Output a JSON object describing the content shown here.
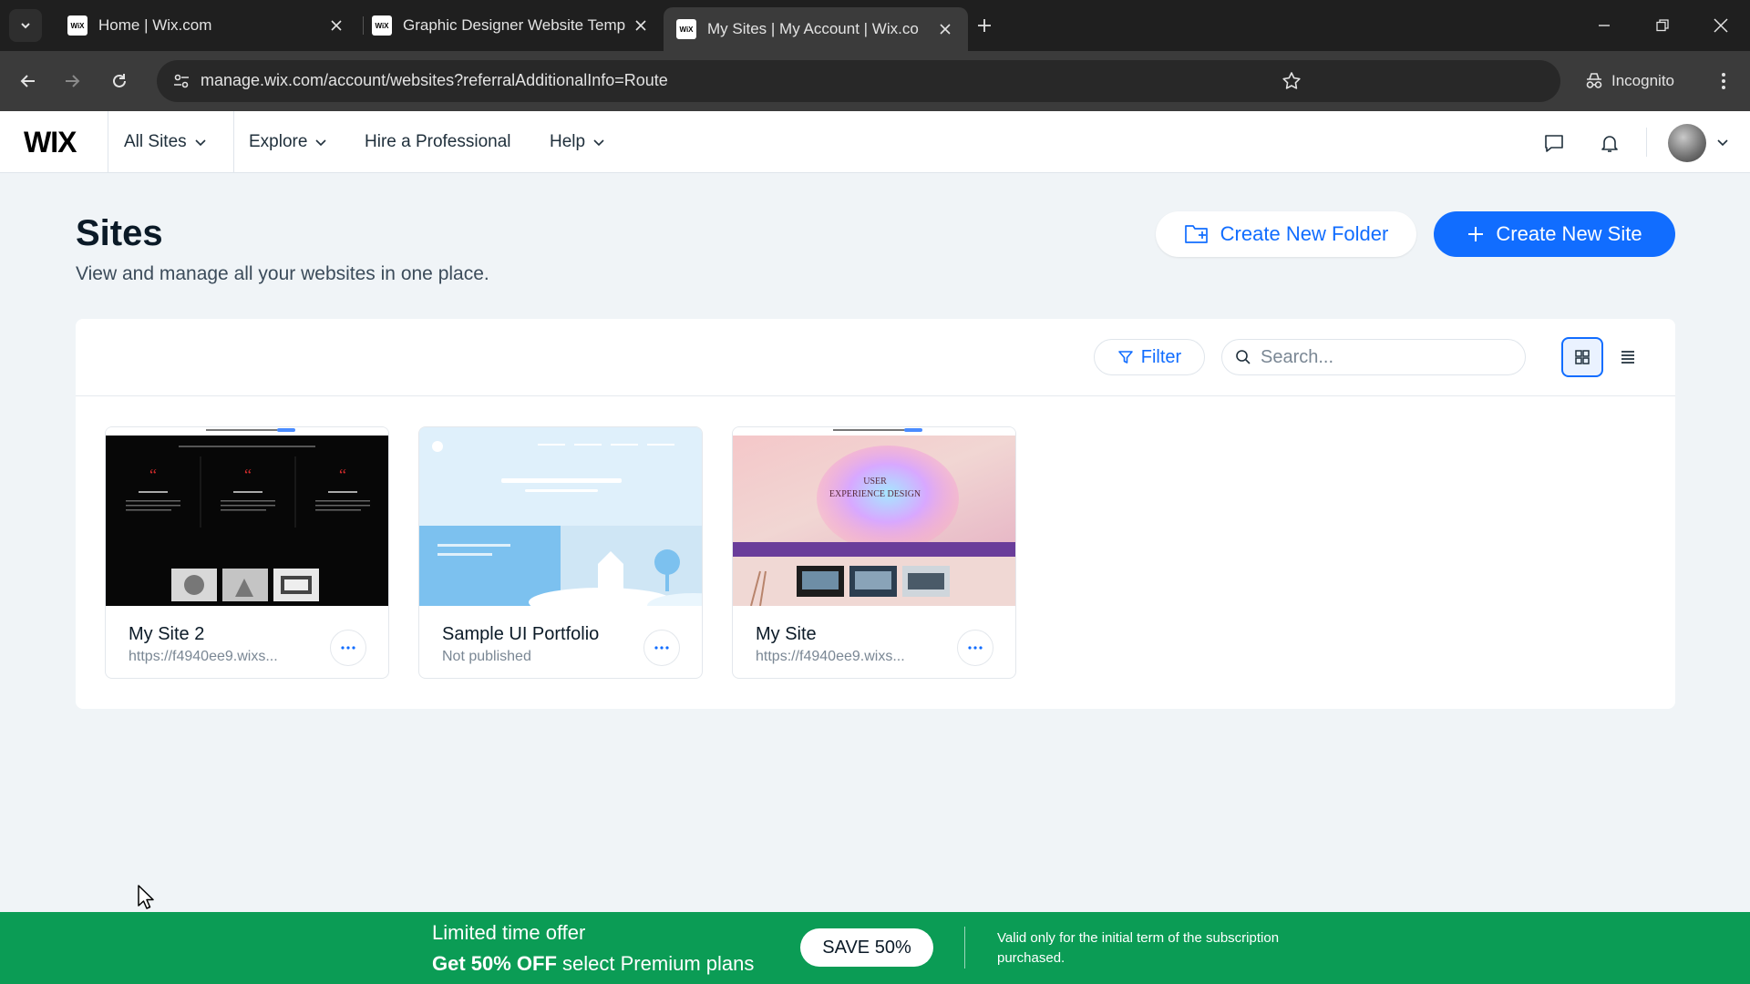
{
  "browser": {
    "tabs": [
      {
        "title": "Home | Wix.com",
        "favicon": "WiX"
      },
      {
        "title": "Graphic Designer Website Temp",
        "favicon": "WiX"
      },
      {
        "title": "My Sites | My Account | Wix.co",
        "favicon": "WiX"
      }
    ],
    "url": "manage.wix.com/account/websites?referralAdditionalInfo=Route",
    "incognito_label": "Incognito"
  },
  "header": {
    "logo": "WIX",
    "nav": [
      {
        "label": "All Sites"
      },
      {
        "label": "Explore"
      },
      {
        "label": "Hire a Professional"
      },
      {
        "label": "Help"
      }
    ]
  },
  "page": {
    "title": "Sites",
    "subtitle": "View and manage all your websites in one place.",
    "create_folder_label": "Create New Folder",
    "create_site_label": "Create New Site"
  },
  "toolbar": {
    "filter_label": "Filter",
    "search_placeholder": "Search..."
  },
  "sites": [
    {
      "name": "My Site 2",
      "status": "https://f4940ee9.wixs..."
    },
    {
      "name": "Sample UI Portfolio",
      "status": "Not published"
    },
    {
      "name": "My Site",
      "status": "https://f4940ee9.wixs...",
      "thumb_text": [
        "USER",
        "EXPERIENCE DESIGN"
      ]
    }
  ],
  "promo": {
    "line1": "Limited time offer",
    "line2_bold": "Get 50% OFF",
    "line2_rest": "select Premium plans",
    "button": "SAVE 50%",
    "note": "Valid only for the initial term of the subscription purchased."
  },
  "colors": {
    "accent": "#116dff",
    "promo": "#0b9c55"
  }
}
